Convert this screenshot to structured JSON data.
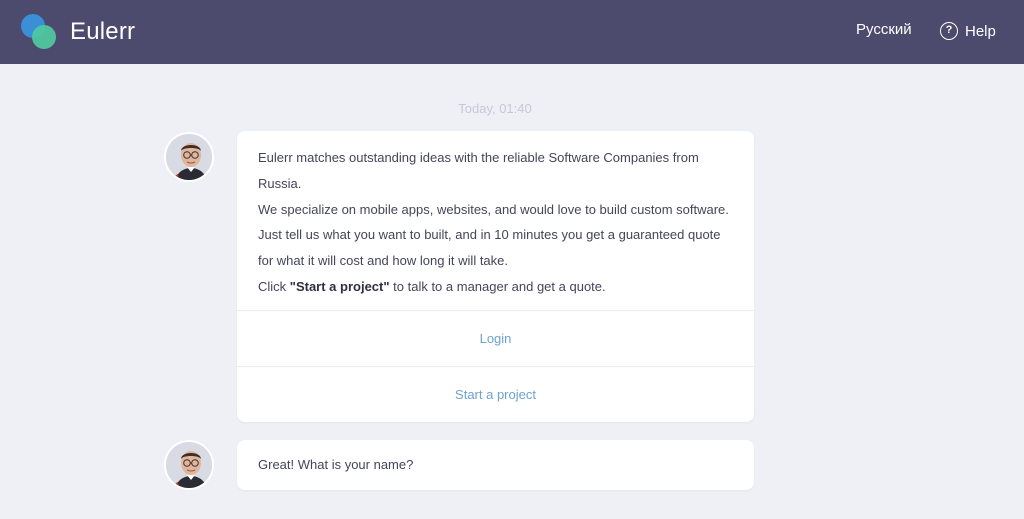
{
  "header": {
    "brand": "Eulerr",
    "language_link": "Русский",
    "help_label": "Help",
    "help_icon_glyph": "?",
    "background_color": "#4c4a6d"
  },
  "chat": {
    "timestamp": "Today, 01:40",
    "messages": [
      {
        "lines": [
          "Eulerr matches outstanding ideas with the reliable Software Companies from Russia.",
          "We specialize on mobile apps, websites, and would love to build custom software.",
          "Just tell us what you want to built, and in 10 minutes you get a guaranteed quote for what it will cost and how long it will take."
        ],
        "cta_prefix": "Click ",
        "cta_bold": "\"Start a project\"",
        "cta_suffix": " to talk to a manager and get a quote.",
        "actions": {
          "login": "Login",
          "start_project": "Start a project"
        }
      },
      {
        "text": "Great! What is your name?"
      }
    ]
  },
  "colors": {
    "page_background": "#eff0f5",
    "link_color": "#6ea3cf",
    "logo_blue": "#3a8fd6",
    "logo_green": "#4fc9a1"
  }
}
